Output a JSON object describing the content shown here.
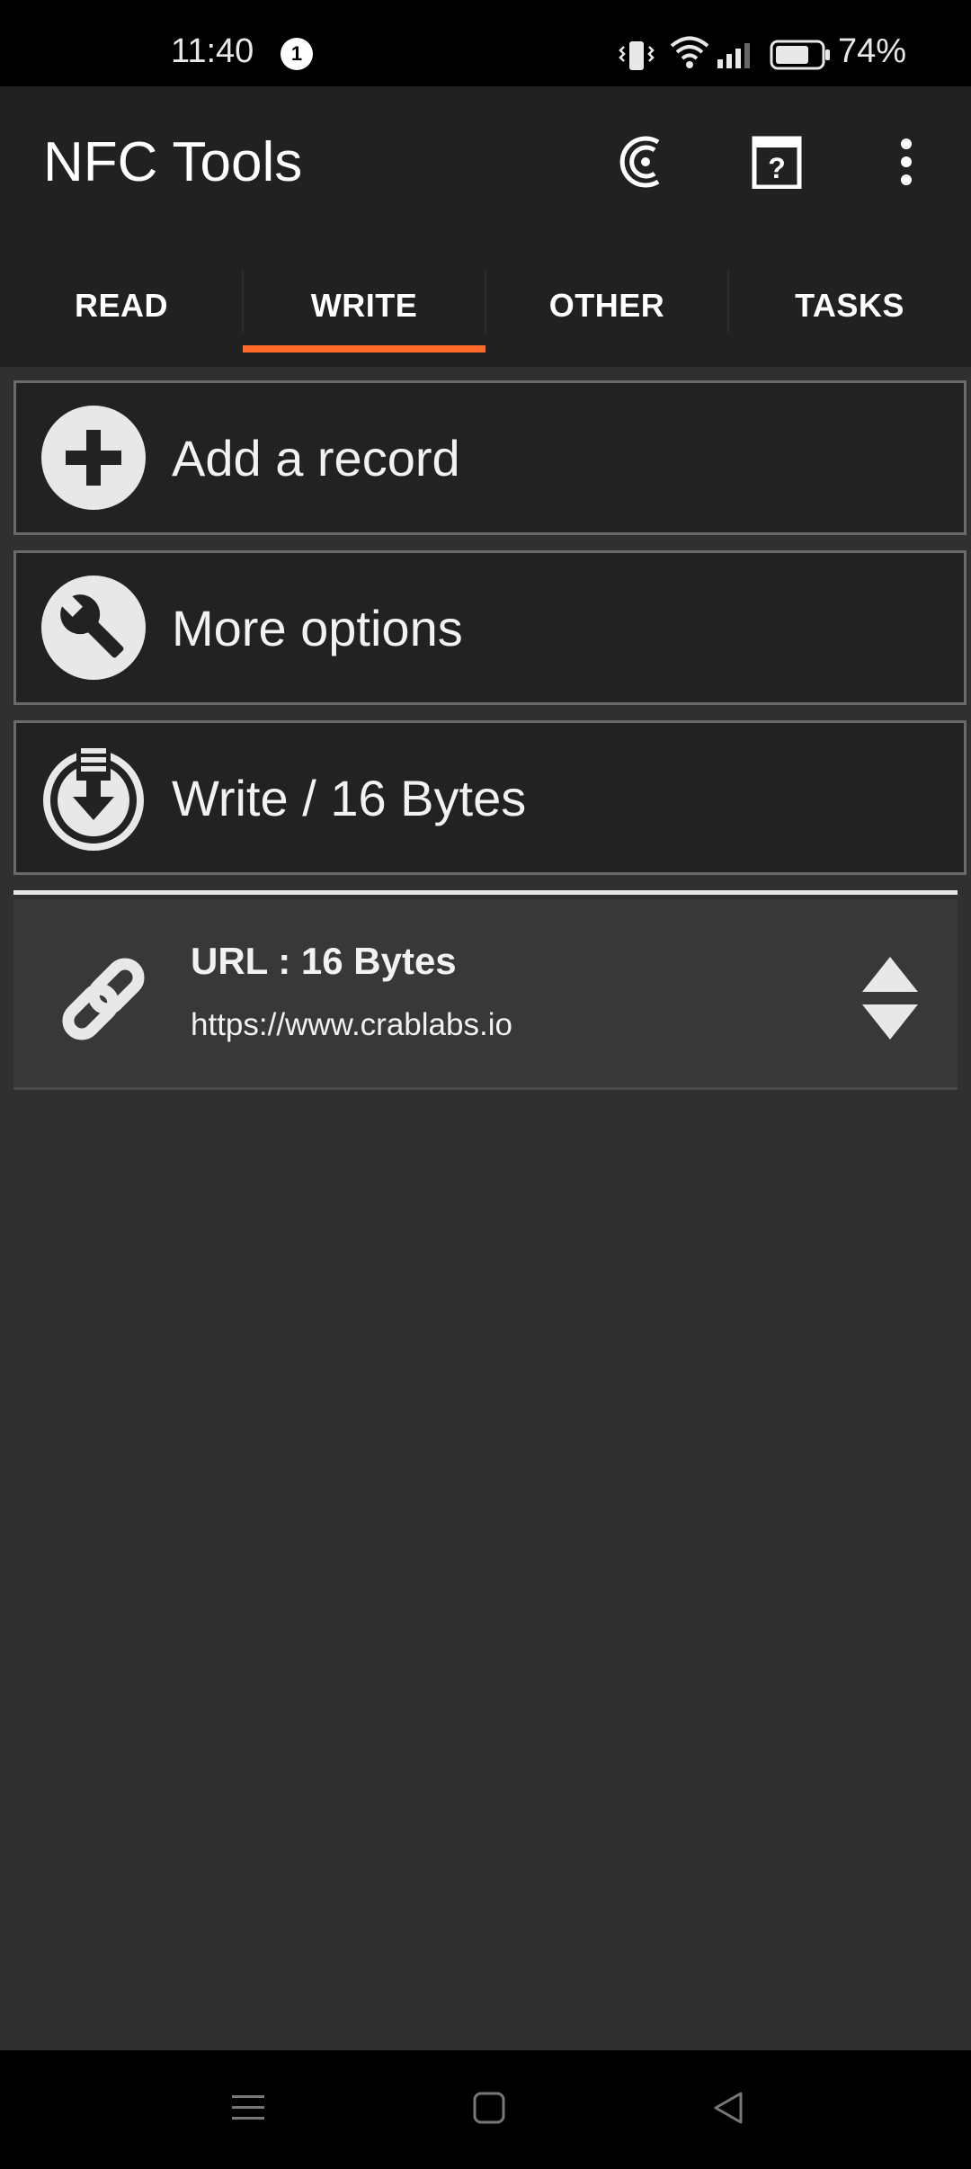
{
  "status_bar": {
    "time": "11:40",
    "notification_count": "1",
    "battery_percent": "74%"
  },
  "app_bar": {
    "title": "NFC Tools"
  },
  "tabs": [
    {
      "label": "READ",
      "active": false
    },
    {
      "label": "WRITE",
      "active": true
    },
    {
      "label": "OTHER",
      "active": false
    },
    {
      "label": "TASKS",
      "active": false
    }
  ],
  "actions": {
    "add_record": "Add a record",
    "more_options": "More options",
    "write": "Write / 16 Bytes"
  },
  "records": [
    {
      "title": "URL : 16 Bytes",
      "value": "https://www.crablabs.io",
      "icon": "link-icon"
    }
  ],
  "colors": {
    "accent": "#ff6a2b",
    "appbar": "#212121",
    "background": "#303030"
  }
}
